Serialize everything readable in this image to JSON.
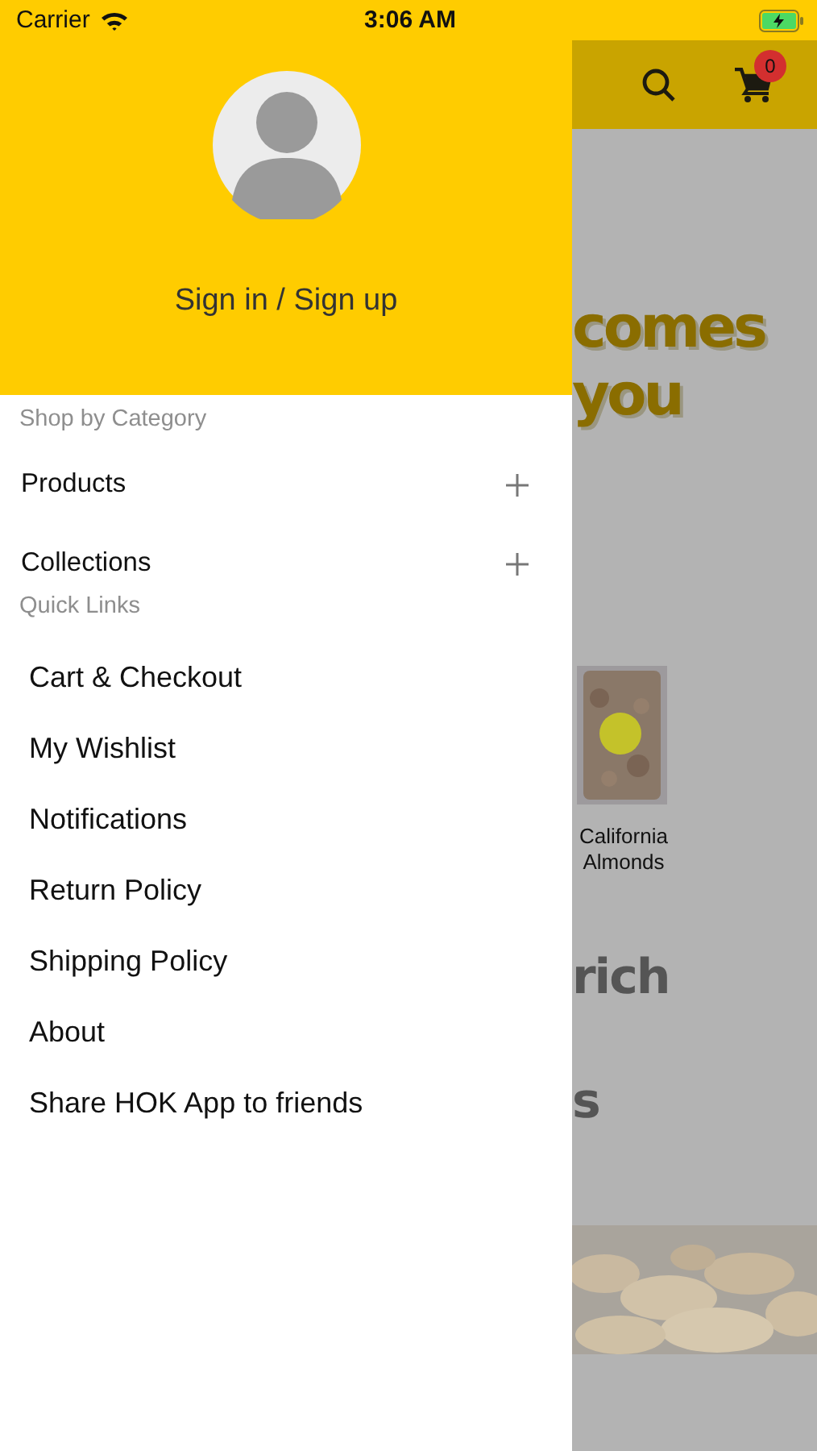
{
  "status_bar": {
    "carrier": "Carrier",
    "time": "3:06 AM"
  },
  "drawer": {
    "account": {
      "label": "Sign in / Sign up"
    },
    "sections": [
      {
        "heading": "Shop by Category",
        "items": [
          {
            "label": "Products",
            "kind": "expandable",
            "expanded": false
          },
          {
            "label": "Collections",
            "kind": "expandable",
            "expanded": false
          }
        ]
      },
      {
        "heading": "Quick Links",
        "items": [
          {
            "label": "Cart & Checkout",
            "kind": "link"
          },
          {
            "label": "My Wishlist",
            "kind": "link"
          },
          {
            "label": "Notifications",
            "kind": "link"
          },
          {
            "label": "Return Policy",
            "kind": "link"
          },
          {
            "label": "Shipping Policy",
            "kind": "link"
          },
          {
            "label": "About",
            "kind": "link"
          },
          {
            "label": "Share HOK App to friends",
            "kind": "link"
          }
        ]
      }
    ]
  },
  "background_page": {
    "cart_count": "0",
    "banner_lines": [
      "comes",
      "you"
    ],
    "product": {
      "name": "California Almonds"
    },
    "headline_lines": [
      "rich",
      "s"
    ]
  }
}
